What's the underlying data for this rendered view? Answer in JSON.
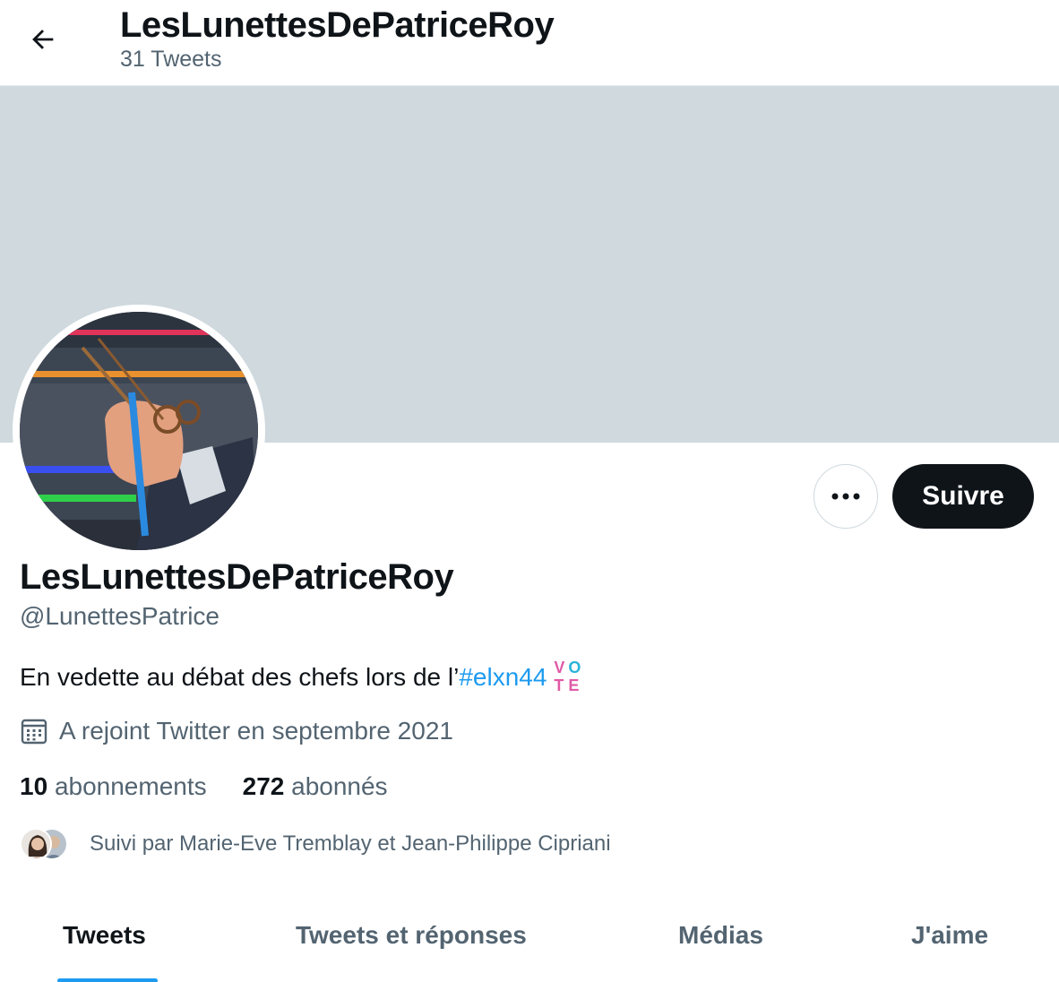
{
  "header": {
    "title": "LesLunettesDePatriceRoy",
    "tweet_count": "31 Tweets"
  },
  "profile": {
    "display_name": "LesLunettesDePatriceRoy",
    "handle": "@LunettesPatrice",
    "bio_text": "En vedette au débat des chefs lors de l’",
    "bio_hashtag": "#elxn44",
    "vote_badge": [
      "V",
      "O",
      "T",
      "E"
    ],
    "joined": "A rejoint Twitter en septembre 2021",
    "following_count": "10",
    "following_label": "abonnements",
    "followers_count": "272",
    "followers_label": "abonnés",
    "followed_by": "Suivi par Marie-Eve Tremblay et Jean-Philippe Cipriani"
  },
  "actions": {
    "follow_label": "Suivre"
  },
  "tabs": [
    {
      "label": "Tweets",
      "active": true
    },
    {
      "label": "Tweets et réponses",
      "active": false
    },
    {
      "label": "Médias",
      "active": false
    },
    {
      "label": "J'aime",
      "active": false
    }
  ],
  "colors": {
    "accent": "#1d9bf0",
    "banner": "#cfd9de",
    "text_primary": "#0f1419",
    "text_secondary": "#536471",
    "follow_button_bg": "#0f1419"
  },
  "icons": {
    "back": "arrow-left-icon",
    "more": "more-dots-icon",
    "joined": "calendar-icon"
  }
}
